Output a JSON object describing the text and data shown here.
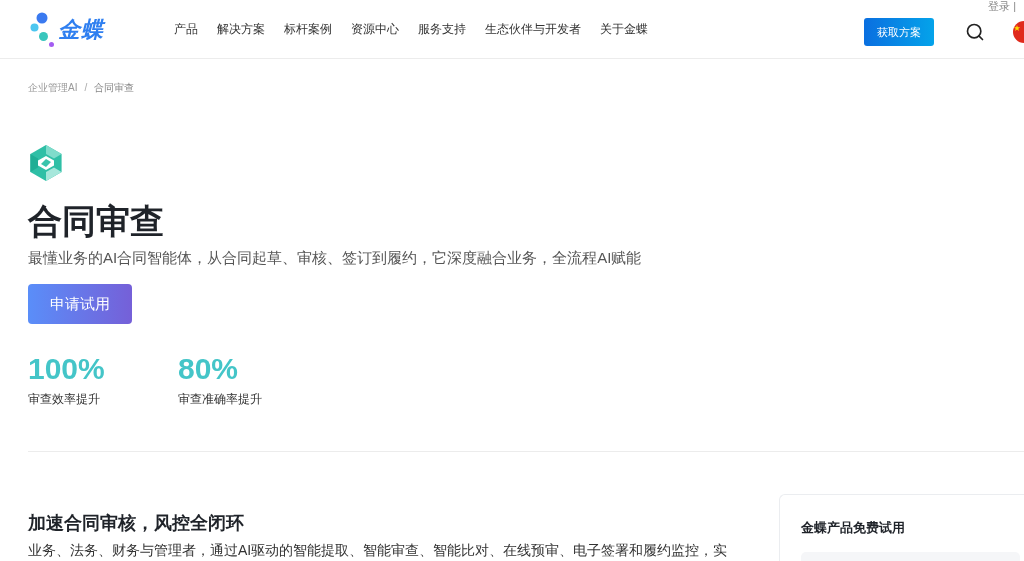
{
  "header": {
    "logo": {
      "text": "金蝶"
    },
    "nav": [
      "产品",
      "解决方案",
      "标杆案例",
      "资源中心",
      "服务支持",
      "生态伙伴与开发者",
      "关于金蝶"
    ],
    "login": "登录 |",
    "cta_button": "获取方案"
  },
  "breadcrumb": {
    "items": [
      "企业管理AI",
      "合同审查"
    ],
    "separator": "/"
  },
  "hero": {
    "title": "合同审查",
    "subtitle": "最懂业务的AI合同智能体，从合同起草、审核、签订到履约，它深度融合业务，全流程AI赋能",
    "button": "申请试用",
    "stats": [
      {
        "value": "100%",
        "label": "审查效率提升"
      },
      {
        "value": "80%",
        "label": "审查准确率提升"
      }
    ]
  },
  "section": {
    "heading": "加速合同审核，风控全闭环",
    "text": "业务、法务、财务与管理者，通过AI驱动的智能提取、智能审查、智能比对、在线预审、电子签署和履约监控，实"
  },
  "trial_card": {
    "title": "金蝶产品免费试用"
  }
}
